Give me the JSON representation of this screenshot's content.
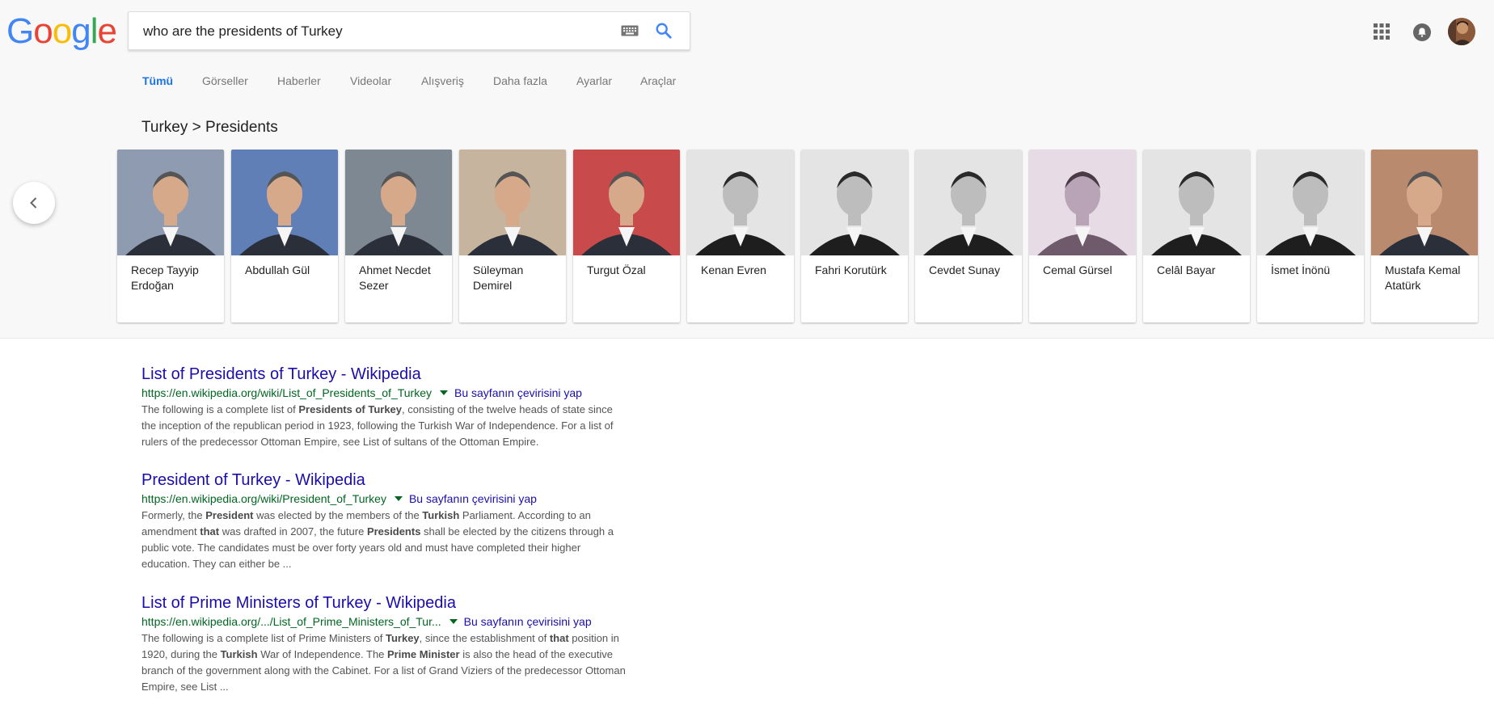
{
  "header": {
    "logo": {
      "letters": [
        "G",
        "o",
        "o",
        "g",
        "l",
        "e"
      ],
      "colors": [
        "#4285F4",
        "#EA4335",
        "#FBBC05",
        "#4285F4",
        "#34A853",
        "#EA4335"
      ]
    },
    "search": {
      "value": "who are the presidents of Turkey"
    },
    "icons": {
      "keyboard": "keyboard-icon",
      "search": "search-icon",
      "apps": "apps-icon",
      "notifications": "notifications-icon"
    }
  },
  "tabs": [
    {
      "label": "Tümü",
      "active": true
    },
    {
      "label": "Görseller"
    },
    {
      "label": "Haberler"
    },
    {
      "label": "Videolar"
    },
    {
      "label": "Alışveriş"
    },
    {
      "label": "Daha fazla"
    },
    {
      "label": "Ayarlar"
    },
    {
      "label": "Araçlar"
    }
  ],
  "carousel": {
    "breadcrumb": "Turkey > Presidents",
    "items": [
      {
        "name": "Recep Tayyip Erdoğan",
        "photo": "color"
      },
      {
        "name": "Abdullah Gül",
        "photo": "color"
      },
      {
        "name": "Ahmet Necdet Sezer",
        "photo": "color"
      },
      {
        "name": "Süleyman Demirel",
        "photo": "color"
      },
      {
        "name": "Turgut Özal",
        "photo": "color"
      },
      {
        "name": "Kenan Evren",
        "photo": "bw"
      },
      {
        "name": "Fahri Korutürk",
        "photo": "bw"
      },
      {
        "name": "Cevdet Sunay",
        "photo": "bw"
      },
      {
        "name": "Cemal Gürsel",
        "photo": "tinted"
      },
      {
        "name": "Celâl Bayar",
        "photo": "bw"
      },
      {
        "name": "İsmet İnönü",
        "photo": "bw"
      },
      {
        "name": "Mustafa Kemal Atatürk",
        "photo": "color"
      }
    ]
  },
  "results": [
    {
      "title": "List of Presidents of Turkey - Wikipedia",
      "url": "https://en.wikipedia.org/wiki/List_of_Presidents_of_Turkey",
      "translate": "Bu sayfanın çevirisini yap",
      "snippet_lines": [
        [
          "The following is a complete list of ",
          {
            "b": "Presidents of Turkey"
          },
          ", consisting of the twelve heads of state since"
        ],
        [
          "the inception of the republican period in 1923, following the Turkish War of Independence. For a list of"
        ],
        [
          "rulers of the predecessor Ottoman Empire, see List of sultans of the Ottoman Empire."
        ]
      ]
    },
    {
      "title": "President of Turkey - Wikipedia",
      "url": "https://en.wikipedia.org/wiki/President_of_Turkey",
      "translate": "Bu sayfanın çevirisini yap",
      "snippet_lines": [
        [
          "Formerly, the ",
          {
            "b": "President"
          },
          " was elected by the members of the ",
          {
            "b": "Turkish"
          },
          " Parliament. According to an"
        ],
        [
          "amendment ",
          {
            "b": "that"
          },
          " was drafted in 2007, the future ",
          {
            "b": "Presidents"
          },
          " shall be elected by the citizens through a"
        ],
        [
          "public vote. The candidates must be over forty years old and must have completed their higher"
        ],
        [
          "education. They can either be ..."
        ]
      ]
    },
    {
      "title": "List of Prime Ministers of Turkey - Wikipedia",
      "url": "https://en.wikipedia.org/.../List_of_Prime_Ministers_of_Tur...",
      "translate": "Bu sayfanın çevirisini yap",
      "snippet_lines": [
        [
          "The following is a complete list of Prime Ministers of ",
          {
            "b": "Turkey"
          },
          ", since the establishment of ",
          {
            "b": "that"
          },
          " position in"
        ],
        [
          "1920, during the ",
          {
            "b": "Turkish"
          },
          " War of Independence. The ",
          {
            "b": "Prime Minister"
          },
          " is also the head of the executive"
        ],
        [
          "branch of the government along with the Cabinet. For a list of Grand Viziers of the predecessor Ottoman"
        ],
        [
          "Empire, see List ..."
        ]
      ]
    }
  ]
}
